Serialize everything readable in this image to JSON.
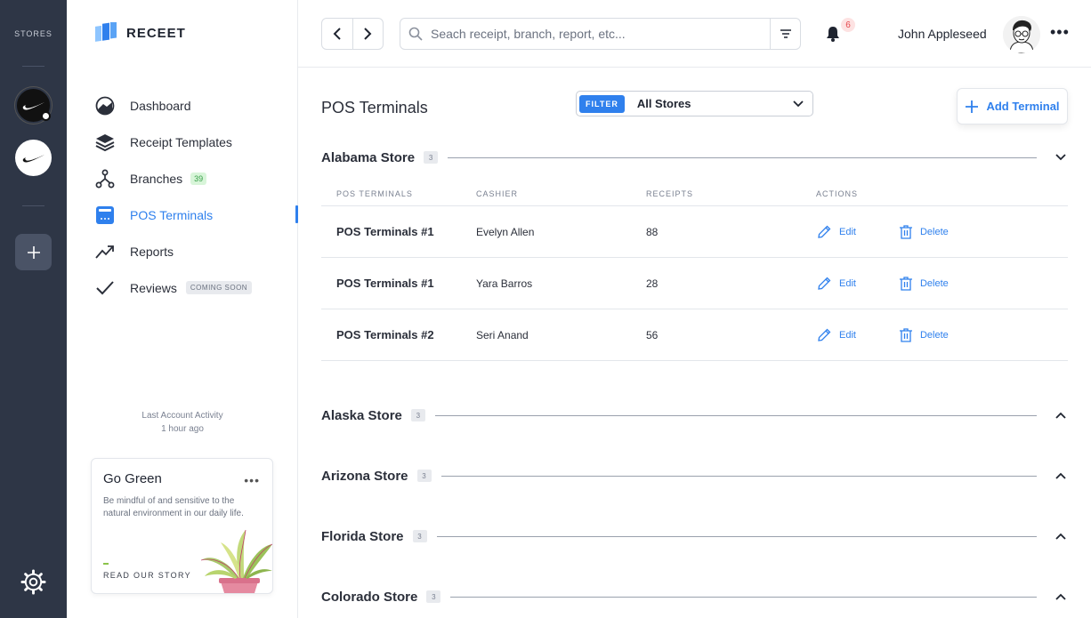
{
  "rail": {
    "title": "STORES"
  },
  "brand": {
    "name": "RECEET"
  },
  "nav": {
    "items": [
      {
        "label": "Dashboard"
      },
      {
        "label": "Receipt Templates"
      },
      {
        "label": "Branches",
        "badge": "39"
      },
      {
        "label": "POS Terminals",
        "active": true
      },
      {
        "label": "Reports"
      },
      {
        "label": "Reviews",
        "badge": "COMING SOON"
      }
    ]
  },
  "activity": {
    "label": "Last Account Activity",
    "time": "1 hour ago"
  },
  "card": {
    "title": "Go Green",
    "text": "Be mindful of and sensitive to the natural environment in our daily life.",
    "link": "READ OUR STORY"
  },
  "topbar": {
    "search_placeholder": "Seach receipt, branch, report, etc...",
    "notifications": "6",
    "user_name": "John Appleseed"
  },
  "main": {
    "title": "POS Terminals",
    "filter_tag": "FILTER",
    "filter_value": "All Stores",
    "add_label": "Add Terminal",
    "columns": [
      "POS TERMINALS",
      "CASHIER",
      "RECEIPTS",
      "ACTIONS"
    ],
    "edit_label": "Edit",
    "delete_label": "Delete",
    "groups": [
      {
        "name": "Alabama Store",
        "count": "3",
        "expanded": true,
        "rows": [
          {
            "terminal": "POS Terminals #1",
            "cashier": "Evelyn Allen",
            "receipts": "88"
          },
          {
            "terminal": "POS Terminals #1",
            "cashier": "Yara Barros",
            "receipts": "28"
          },
          {
            "terminal": "POS Terminals #2",
            "cashier": "Seri Anand",
            "receipts": "56"
          }
        ]
      },
      {
        "name": "Alaska Store",
        "count": "3",
        "expanded": false
      },
      {
        "name": "Arizona Store",
        "count": "3",
        "expanded": false
      },
      {
        "name": "Florida Store",
        "count": "3",
        "expanded": false
      },
      {
        "name": "Colorado Store",
        "count": "3",
        "expanded": false
      }
    ]
  },
  "colors": {
    "accent": "#2f80ed",
    "rail": "#2e3646",
    "badge_green": "#3aa04a",
    "notification": "#e5484d"
  }
}
